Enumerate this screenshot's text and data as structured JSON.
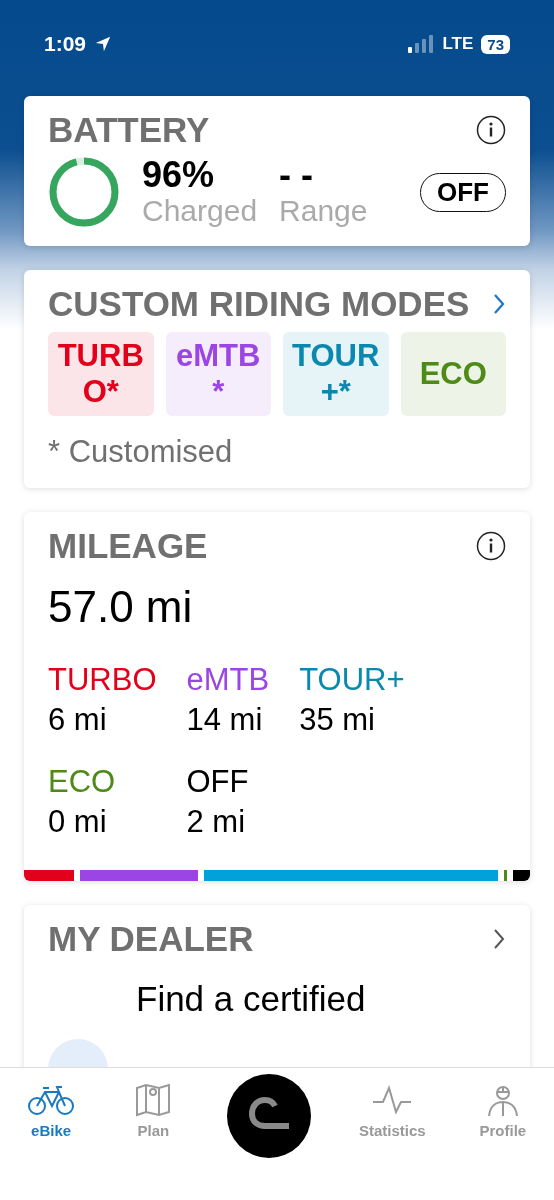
{
  "status_bar": {
    "time": "1:09",
    "network": "LTE",
    "battery": "73"
  },
  "battery": {
    "title": "BATTERY",
    "charge": "96%",
    "charge_label": "Charged",
    "range": "- -",
    "range_label": "Range",
    "mode": "OFF"
  },
  "riding_modes": {
    "title": "CUSTOM RIDING MODES",
    "modes": [
      {
        "label": "TURBO*",
        "color": "#e3001b"
      },
      {
        "label": "eMTB*",
        "color": "#9b45e4"
      },
      {
        "label": "TOUR+*",
        "color": "#0a88b0"
      },
      {
        "label": "ECO",
        "color": "#4e8a17"
      }
    ],
    "note": "* Customised"
  },
  "mileage": {
    "title": "MILEAGE",
    "total": "57.0 mi",
    "modes": [
      {
        "name": "TURBO",
        "distance": "6 mi",
        "color": "#e3001b"
      },
      {
        "name": "eMTB",
        "distance": "14 mi",
        "color": "#9b45e4"
      },
      {
        "name": "TOUR+",
        "distance": "35 mi",
        "color": "#0a88b0"
      },
      {
        "name": "ECO",
        "distance": "0 mi",
        "color": "#4e8a17"
      },
      {
        "name": "OFF",
        "distance": "2 mi",
        "color": "#000000"
      }
    ]
  },
  "dealer": {
    "title": "MY DEALER",
    "text": "Find a certified"
  },
  "tabs": [
    {
      "label": "eBike",
      "selected": true
    },
    {
      "label": "Plan",
      "selected": false
    },
    {
      "label": "Statistics",
      "selected": false
    },
    {
      "label": "Profile",
      "selected": false
    }
  ]
}
